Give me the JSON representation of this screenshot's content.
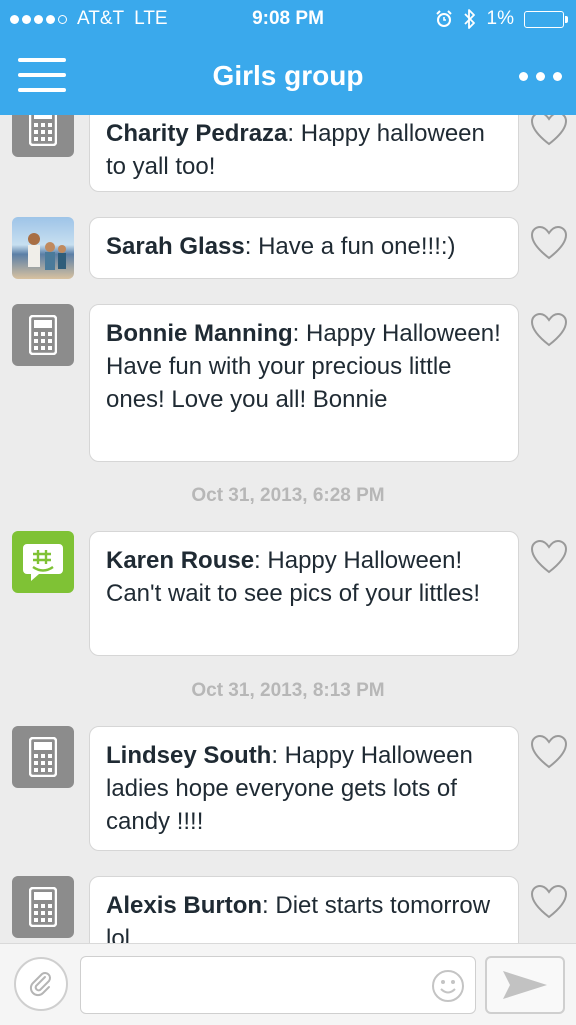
{
  "status_bar": {
    "carrier": "AT&T",
    "network": "LTE",
    "time": "9:08 PM",
    "battery": "1%",
    "signal_bars": 4
  },
  "header": {
    "title": "Girls group",
    "menu_icon": "hamburger-icon",
    "more_icon": "more-dots-icon"
  },
  "messages": [
    {
      "sender": "Charity Pedraza",
      "text": ": Happy halloween to yall too!",
      "avatar": "sms-phone-icon"
    },
    {
      "sender": "Sarah Glass",
      "text": ": Have a fun one!!!:)",
      "avatar": "user-photo"
    },
    {
      "sender": "Bonnie Manning",
      "text": ": Happy Halloween! Have fun with your precious little ones! Love you all! Bonnie",
      "avatar": "sms-phone-icon"
    },
    {
      "sender": "Karen Rouse",
      "text": ": Happy Halloween! Can't wait to see pics of your littles!",
      "avatar": "groupme-icon"
    },
    {
      "sender": "Lindsey South",
      "text": ": Happy Halloween ladies hope everyone gets lots of candy !!!!",
      "avatar": "sms-phone-icon"
    },
    {
      "sender": "Alexis Burton",
      "text": ": Diet starts tomorrow lol",
      "avatar": "sms-phone-icon"
    }
  ],
  "timestamps": [
    "Oct 31, 2013, 6:28 PM",
    "Oct 31, 2013, 8:13 PM"
  ],
  "compose": {
    "placeholder": "",
    "attach_icon": "paperclip-icon",
    "emoji_icon": "smiley-icon",
    "send_icon": "send-arrow-icon"
  },
  "colors": {
    "accent": "#3aa9ec",
    "groupme_green": "#7fc235",
    "sms_gray": "#8c8c8c"
  }
}
